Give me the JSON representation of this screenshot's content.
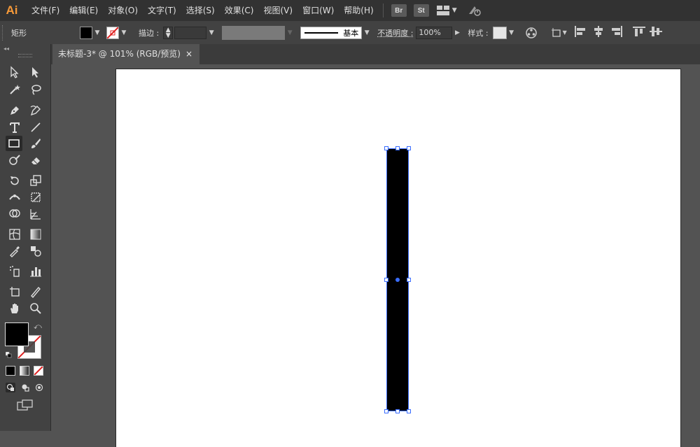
{
  "app": {
    "logo": "Ai"
  },
  "menu": [
    "文件(F)",
    "编辑(E)",
    "对象(O)",
    "文字(T)",
    "选择(S)",
    "效果(C)",
    "视图(V)",
    "窗口(W)",
    "帮助(H)"
  ],
  "apps": {
    "bridge": "Br",
    "stock": "St"
  },
  "control": {
    "tool_name": "矩形",
    "stroke_label": "描边 :",
    "brush_label": "基本",
    "opacity_label": "不透明度 :",
    "opacity_value": "100%",
    "style_label": "样式 :"
  },
  "document": {
    "tab_title": "未标题-3* @ 101% (RGB/预览)",
    "close": "×"
  },
  "colors": {
    "accent": "#3a6dff",
    "logo": "#f79a39"
  }
}
